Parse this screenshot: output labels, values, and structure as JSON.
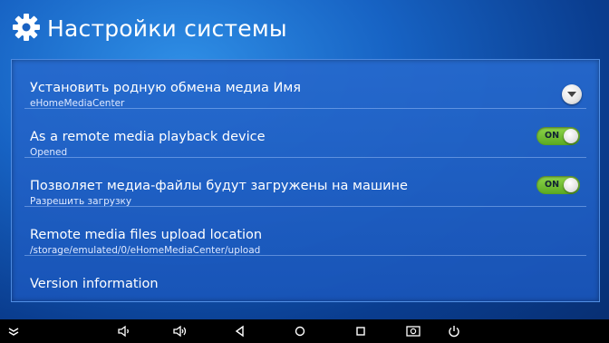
{
  "header": {
    "title": "Настройки системы",
    "icon": "gear-icon"
  },
  "settings": [
    {
      "title": "Установить родную обмена медиа Имя",
      "subtitle": "eHomeMediaCenter",
      "control": "dropdown"
    },
    {
      "title": "As a remote media playback device",
      "subtitle": "Opened",
      "control": "toggle",
      "toggle_label": "ON"
    },
    {
      "title": "Позволяет медиа-файлы будут загружены на машине",
      "subtitle": "Разрешить загрузку",
      "control": "toggle",
      "toggle_label": "ON"
    },
    {
      "title": "Remote media files upload location",
      "subtitle": "/storage/emulated/0/eHomeMediaCenter/upload",
      "control": "none"
    },
    {
      "title": "Version information",
      "subtitle": "",
      "control": "none"
    }
  ],
  "navbar": {
    "icons": [
      "hide-bar-icon",
      "volume-down-icon",
      "volume-up-icon",
      "back-icon",
      "home-icon",
      "recents-icon",
      "screenshot-icon",
      "power-icon"
    ]
  },
  "colors": {
    "background": "#1763c4",
    "panel": "#2669cd",
    "toggle_on": "#7cc83a",
    "navbar": "#000000"
  }
}
